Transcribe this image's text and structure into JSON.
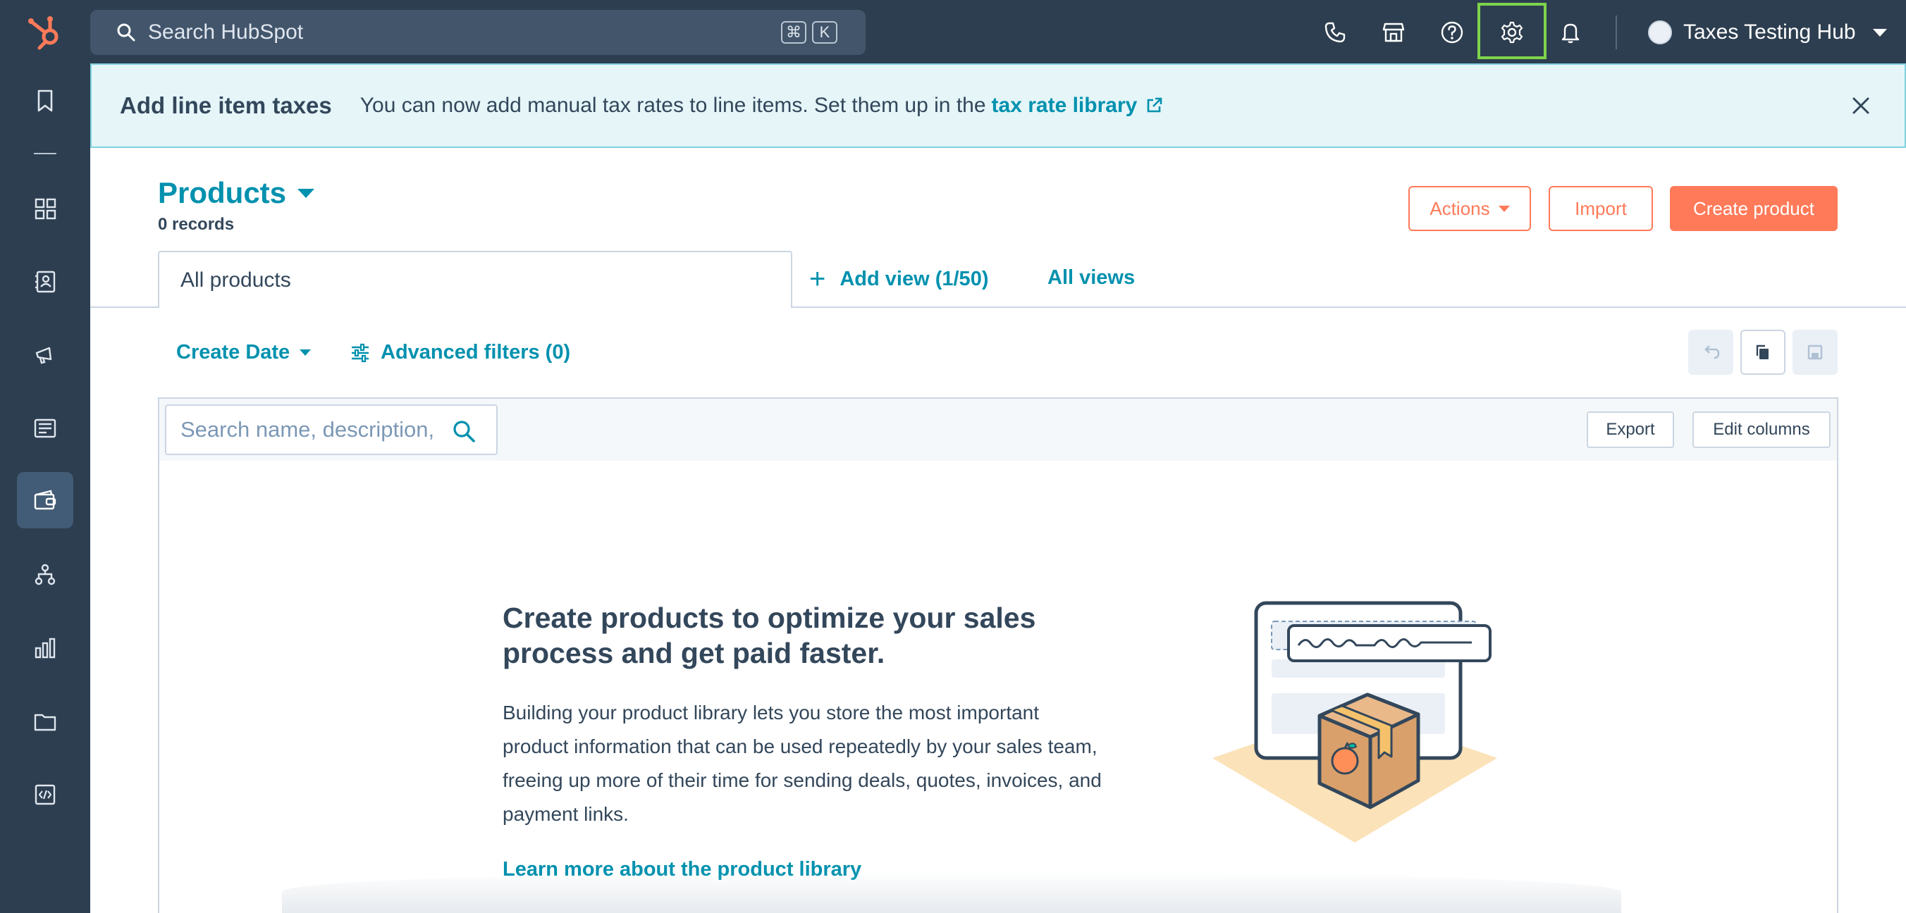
{
  "topbar": {
    "search_placeholder": "Search HubSpot",
    "shortcut_keys": [
      "⌘",
      "K"
    ],
    "icons": [
      "calling-icon",
      "marketplace-icon",
      "help-icon",
      "settings-icon",
      "notifications-icon"
    ],
    "account_name": "Taxes Testing Hub"
  },
  "sidenav": {
    "items": [
      "bookmarks-icon",
      "workspaces-icon",
      "contacts-icon",
      "marketing-icon",
      "content-icon",
      "commerce-icon",
      "automation-icon",
      "reporting-icon",
      "library-icon",
      "development-icon"
    ],
    "active": "commerce-icon"
  },
  "banner": {
    "title": "Add line item taxes",
    "text": "You can now add manual tax rates to line items. Set them up in the",
    "link": "tax rate library"
  },
  "header": {
    "title": "Products",
    "records": "0 records",
    "actions_label": "Actions",
    "import_label": "Import",
    "create_label": "Create product"
  },
  "views": {
    "active_tab": "All products",
    "add_view": "Add view (1/50)",
    "all_views": "All views"
  },
  "filters": {
    "create_date": "Create Date",
    "advanced": "Advanced filters (0)"
  },
  "table": {
    "search_placeholder": "Search name, description, or SKU",
    "export_label": "Export",
    "edit_columns_label": "Edit columns"
  },
  "empty_state": {
    "title_line1": "Create products to optimize your sales",
    "title_line2": "process and get paid faster.",
    "description": "Building your product library lets you store the most important product information that can be used repeatedly by your sales team, freeing up more of their time for sending deals, quotes, invoices, and payment links.",
    "link": "Learn more about the product library"
  },
  "colors": {
    "nav_bg": "#2d3e50",
    "accent_teal": "#0091ae",
    "accent_orange": "#ff7a59",
    "highlight_green": "#7fd44c"
  }
}
